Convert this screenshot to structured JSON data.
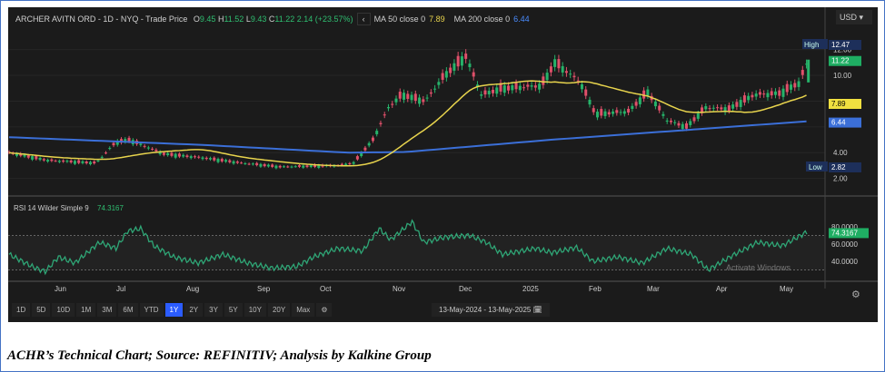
{
  "header": {
    "title": "ARCHER AVITN ORD - 1D - NYQ - Trade Price",
    "o_label": "O",
    "o": "9.45",
    "h_label": "H",
    "h": "11.52",
    "l_label": "L",
    "l": "9.43",
    "c_label": "C",
    "c": "11.22",
    "change": "2.14 (+23.57%)",
    "ma50_label": "MA 50 close 0",
    "ma50": "7.89",
    "ma200_label": "MA 200 close 0",
    "ma200": "6.44",
    "collapse": "‹"
  },
  "currency": "USD ▾",
  "chart_data": {
    "type": "candlestick",
    "price_axis": {
      "ticks": [
        "12.00",
        "10.00",
        "4.00",
        "2.00"
      ],
      "range": [
        1.2,
        13
      ]
    },
    "badges": {
      "high_label": "High",
      "high": "12.47",
      "last": "11.22",
      "ma50": "7.89",
      "ma200": "6.44",
      "low_label": "Low",
      "low": "2.82"
    },
    "price_keypoints": [
      [
        0,
        4.0
      ],
      [
        20,
        3.4
      ],
      [
        45,
        3.2
      ],
      [
        55,
        4.8
      ],
      [
        62,
        5.0
      ],
      [
        80,
        3.9
      ],
      [
        100,
        3.6
      ],
      [
        120,
        3.2
      ],
      [
        140,
        2.9
      ],
      [
        170,
        3.0
      ],
      [
        178,
        3.2
      ],
      [
        188,
        5.0
      ],
      [
        196,
        7.5
      ],
      [
        203,
        8.5
      ],
      [
        215,
        8.0
      ],
      [
        225,
        10
      ],
      [
        236,
        11.5
      ],
      [
        244,
        8.5
      ],
      [
        255,
        9.0
      ],
      [
        275,
        9.2
      ],
      [
        282,
        11.0
      ],
      [
        295,
        9.5
      ],
      [
        303,
        7.0
      ],
      [
        320,
        7.2
      ],
      [
        330,
        8.7
      ],
      [
        340,
        6.5
      ],
      [
        350,
        6.0
      ],
      [
        360,
        7.5
      ],
      [
        372,
        7.4
      ],
      [
        385,
        8.5
      ],
      [
        398,
        8.6
      ],
      [
        408,
        9.4
      ],
      [
        413,
        11.22
      ]
    ],
    "ma200_keypoints": [
      [
        0,
        5.2
      ],
      [
        100,
        4.6
      ],
      [
        175,
        4.0
      ],
      [
        205,
        4.05
      ],
      [
        280,
        5.0
      ],
      [
        413,
        6.44
      ]
    ],
    "rsi": {
      "label": "RSI 14 Wilder Simple 9",
      "value": "74.3167",
      "ticks": [
        "80.0000",
        "60.0000",
        "40.0000"
      ],
      "levels": [
        70,
        30
      ],
      "keypoints": [
        [
          0,
          48
        ],
        [
          15,
          33
        ],
        [
          22,
          28
        ],
        [
          30,
          45
        ],
        [
          40,
          38
        ],
        [
          55,
          62
        ],
        [
          65,
          55
        ],
        [
          72,
          75
        ],
        [
          80,
          78
        ],
        [
          88,
          58
        ],
        [
          100,
          45
        ],
        [
          115,
          38
        ],
        [
          130,
          48
        ],
        [
          145,
          38
        ],
        [
          160,
          32
        ],
        [
          175,
          34
        ],
        [
          185,
          45
        ],
        [
          200,
          55
        ],
        [
          215,
          52
        ],
        [
          225,
          78
        ],
        [
          232,
          65
        ],
        [
          245,
          86
        ],
        [
          252,
          62
        ],
        [
          265,
          68
        ],
        [
          280,
          70
        ],
        [
          290,
          62
        ],
        [
          300,
          48
        ],
        [
          320,
          55
        ],
        [
          330,
          50
        ],
        [
          345,
          56
        ],
        [
          355,
          40
        ],
        [
          370,
          45
        ],
        [
          385,
          38
        ],
        [
          400,
          55
        ],
        [
          415,
          48
        ],
        [
          425,
          30
        ],
        [
          440,
          47
        ],
        [
          455,
          62
        ],
        [
          470,
          58
        ],
        [
          485,
          74
        ]
      ]
    },
    "x_ticks": [
      "Jun",
      "Jul",
      "Aug",
      "Sep",
      "Oct",
      "Nov",
      "Dec",
      "2025",
      "Feb",
      "Mar",
      "Apr",
      "May"
    ]
  },
  "ranges": [
    "1D",
    "5D",
    "10D",
    "1M",
    "3M",
    "6M",
    "YTD",
    "1Y",
    "2Y",
    "3Y",
    "5Y",
    "10Y",
    "20Y",
    "Max"
  ],
  "active_range": "1Y",
  "date_range": "13-May-2024  -  13-May-2025 🗓",
  "watermark": "Activate Windows",
  "caption": "ACHR’s Technical Chart; Source: REFINITIV; Analysis by Kalkine Group"
}
